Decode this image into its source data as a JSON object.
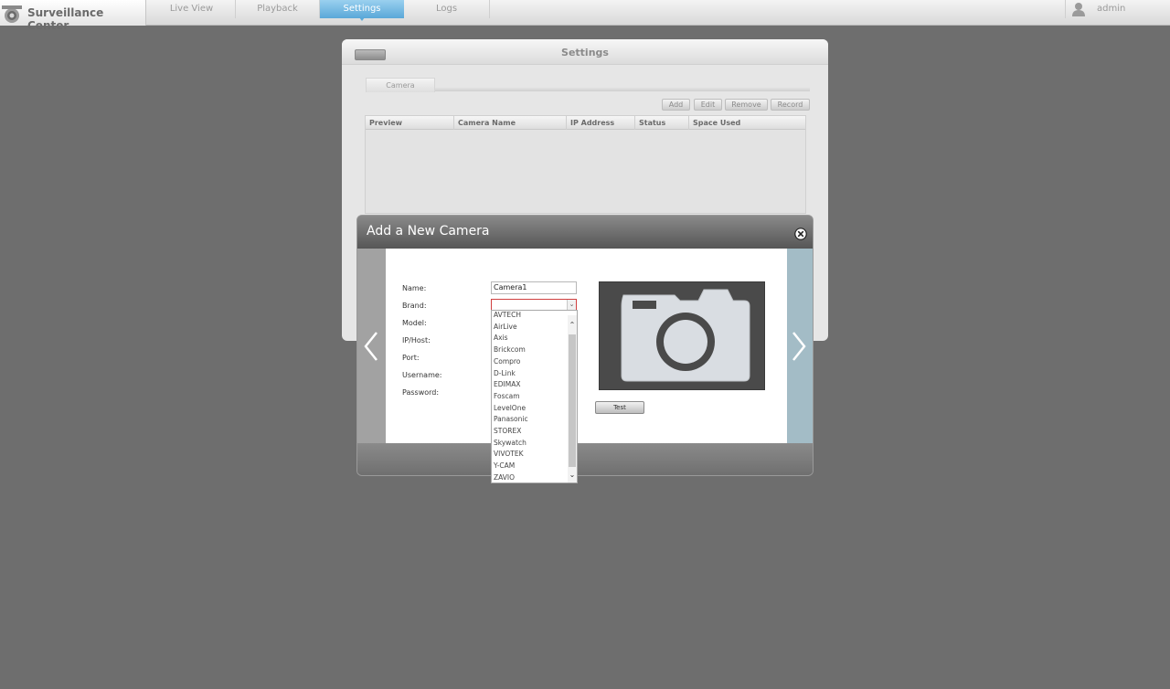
{
  "app": {
    "title": "Surveillance Center",
    "nav": {
      "live_view": "Live View",
      "playback": "Playback",
      "settings": "Settings",
      "logs": "Logs"
    },
    "user": "admin",
    "accent_color": "#5aa8d8"
  },
  "settings_panel": {
    "title": "Settings",
    "back_button_label": "",
    "tab_camera": "Camera",
    "toolbar": {
      "add": "Add",
      "edit": "Edit",
      "remove": "Remove",
      "record": "Record"
    },
    "table": {
      "headers": [
        "Preview",
        "Camera Name",
        "IP Address",
        "Status",
        "Space Used"
      ],
      "rows": []
    }
  },
  "modal": {
    "title": "Add a New Camera",
    "labels": {
      "name": "Name:",
      "brand": "Brand:",
      "model": "Model:",
      "ip_host": "IP/Host:",
      "port": "Port:",
      "username": "Username:",
      "password": "Password:"
    },
    "name_value": "Camera1",
    "brand_value": "",
    "test_button": "Test",
    "preview_icon": "camera-icon",
    "brand_options": [
      "AVTECH",
      "AirLive",
      "Axis",
      "Brickcom",
      "Compro",
      "D-Link",
      "EDIMAX",
      "Foscam",
      "LevelOne",
      "Panasonic",
      "STOREX",
      "Skywatch",
      "VIVOTEK",
      "Y-CAM",
      "ZAVIO"
    ]
  }
}
